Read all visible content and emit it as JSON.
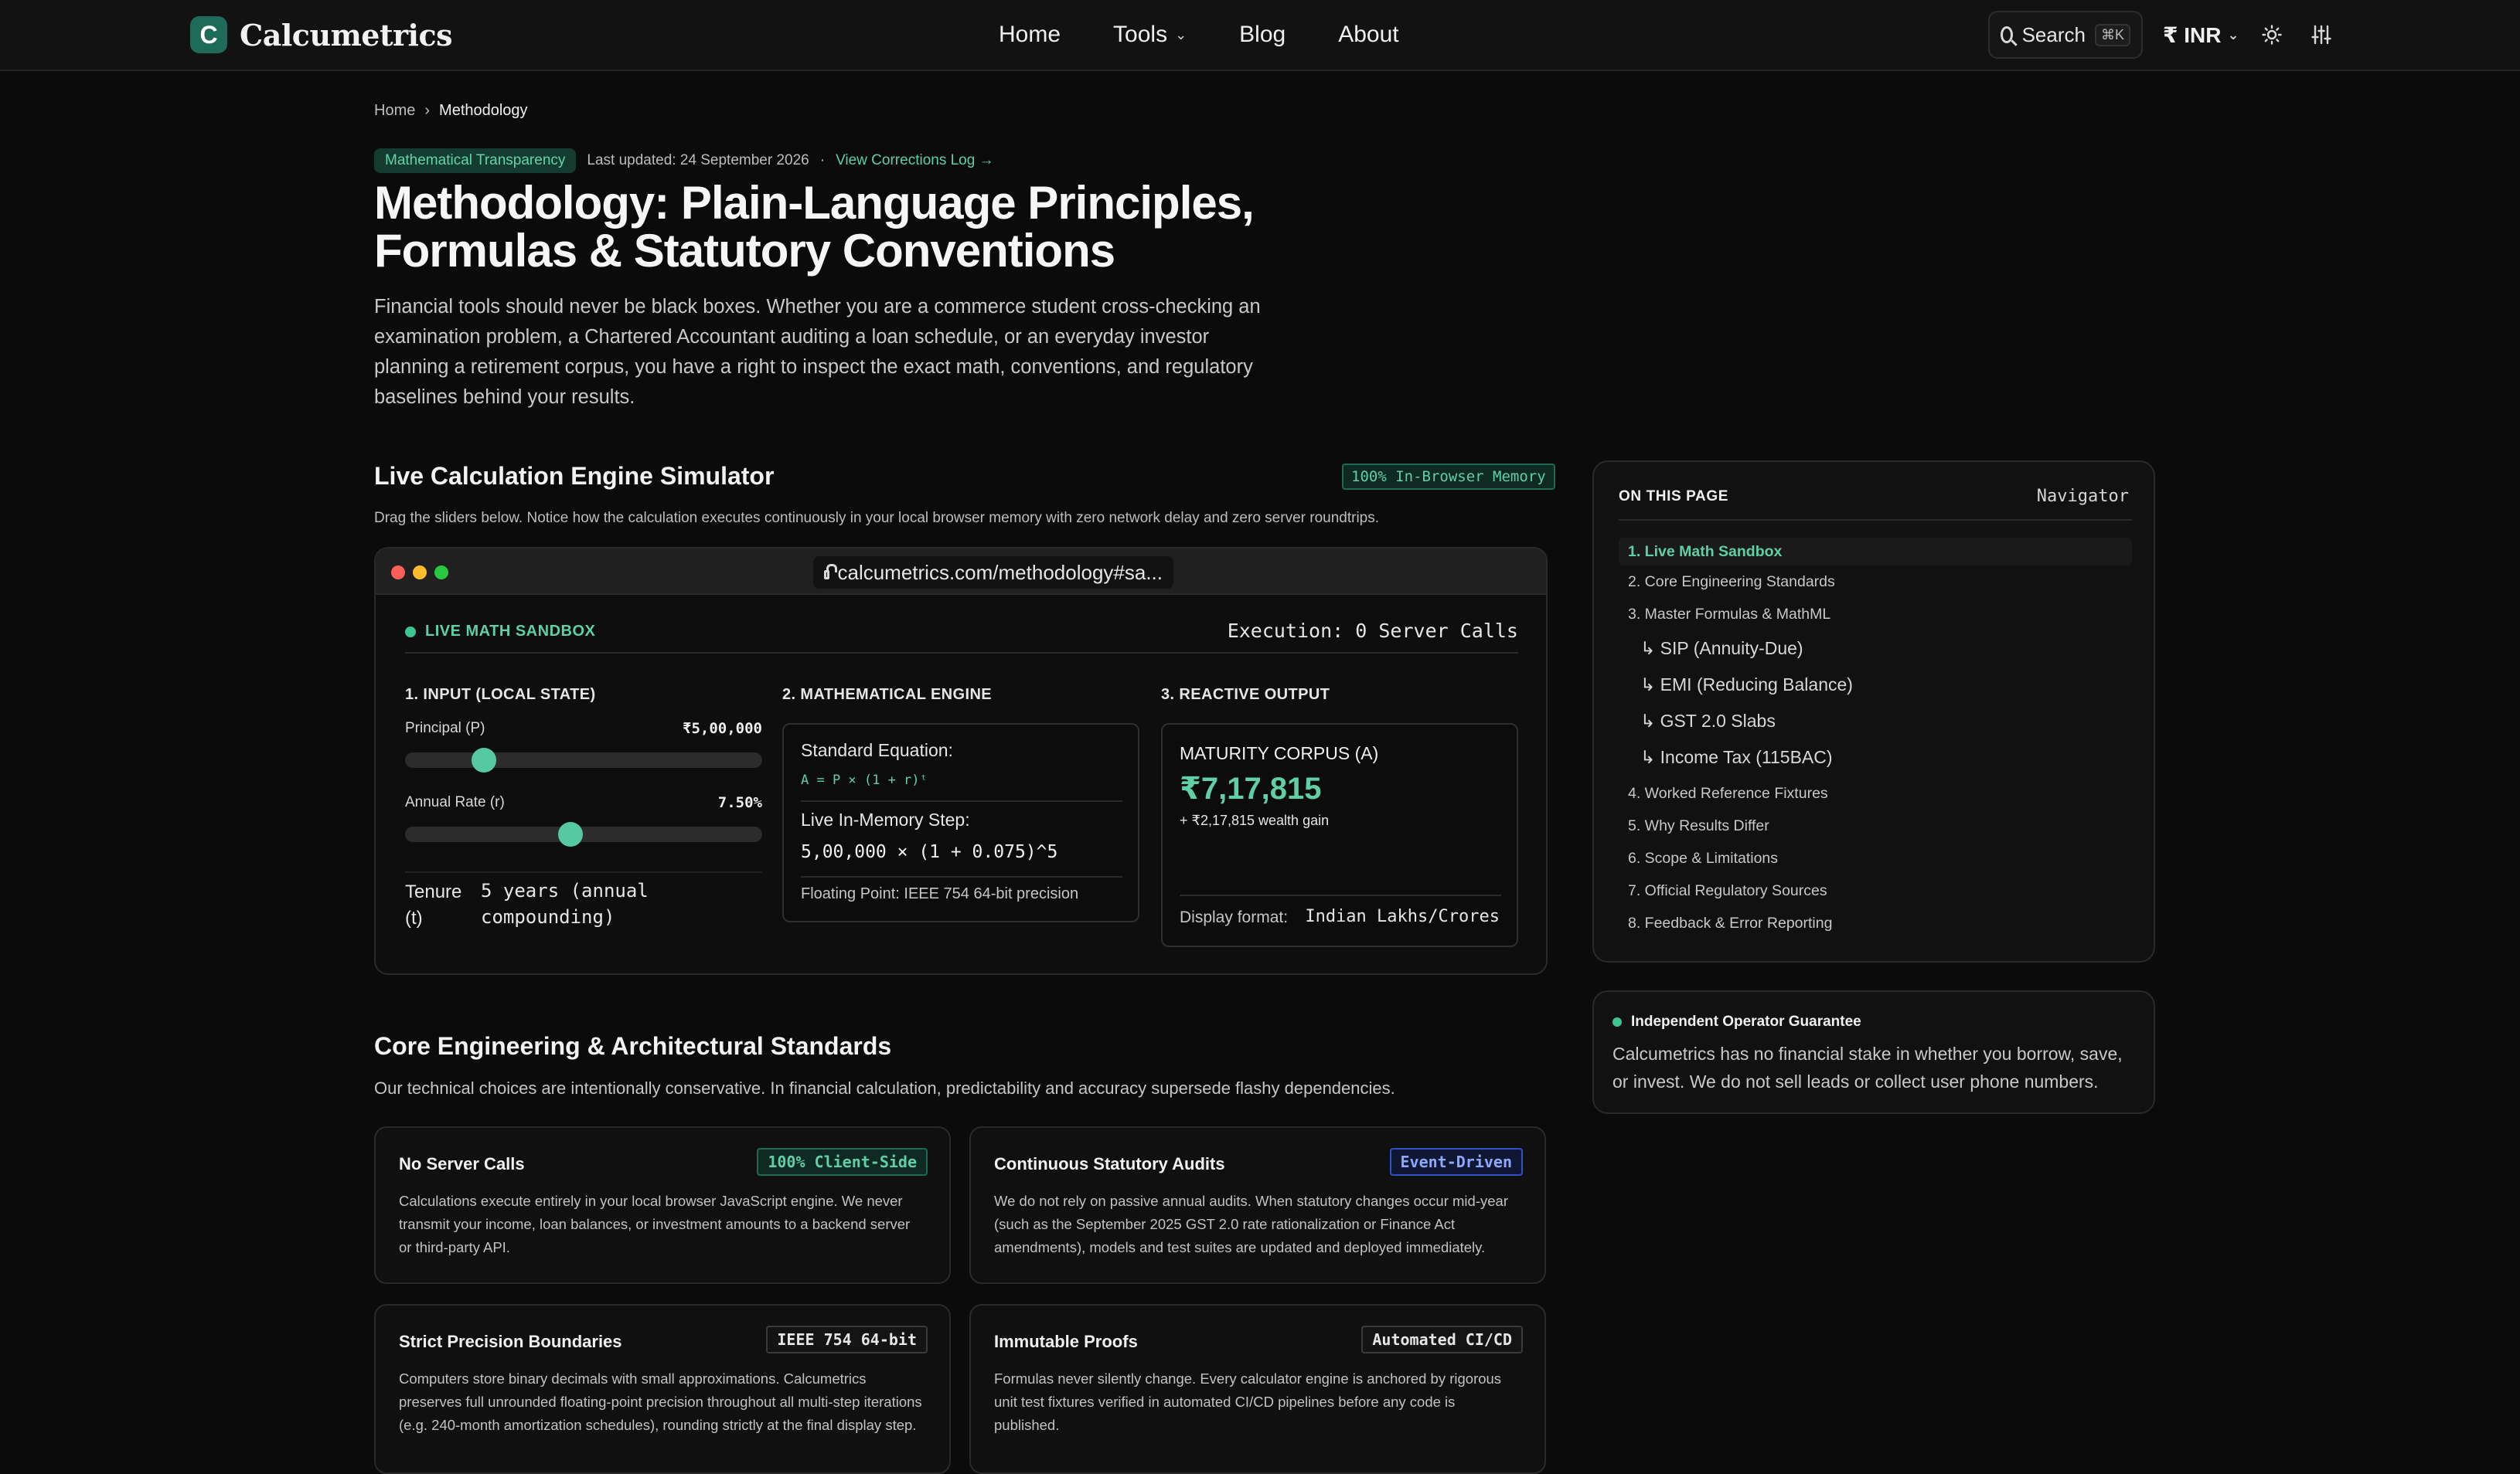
{
  "header": {
    "logo_letter": "C",
    "brand": "Calcumetrics",
    "nav": [
      {
        "label": "Home",
        "has_menu": false
      },
      {
        "label": "Tools",
        "has_menu": true
      },
      {
        "label": "Blog",
        "has_menu": false
      },
      {
        "label": "About",
        "has_menu": false
      }
    ],
    "search_label": "Search",
    "search_shortcut": "⌘K",
    "currency": "₹ INR"
  },
  "breadcrumb": {
    "home": "Home",
    "separator": "›",
    "current": "Methodology"
  },
  "meta": {
    "badge": "Mathematical Transparency",
    "updated": "Last updated: 24 September 2026",
    "dot": "·",
    "corrections_link": "View Corrections Log →"
  },
  "page_title": "Methodology: Plain-Language Principles, Formulas & Statutory Conventions",
  "lead": "Financial tools should never be black boxes. Whether you are a commerce student cross-checking an examination problem, a Chartered Accountant auditing a loan schedule, or an everyday investor planning a retirement corpus, you have a right to inspect the exact math, conventions, and regulatory baselines behind your results.",
  "simulator": {
    "title": "Live Calculation Engine Simulator",
    "badge": "100% In-Browser Memory",
    "description": "Drag the sliders below. Notice how the calculation executes continuously in your local browser memory with zero network delay and zero server roundtrips.",
    "url": "calcumetrics.com/methodology#sa...",
    "sandbox_label": "LIVE MATH SANDBOX",
    "execution": "Execution: 0 Server Calls",
    "input": {
      "heading": "1. INPUT (LOCAL STATE)",
      "principal_label": "Principal (P)",
      "principal_value": "₹5,00,000",
      "principal_fraction": 0.2,
      "rate_label": "Annual Rate (r)",
      "rate_value": "7.50%",
      "rate_fraction": 0.46,
      "tenure_label": "Tenure (t)",
      "tenure_value": "5 years (annual compounding)"
    },
    "engine": {
      "heading": "2. MATHEMATICAL ENGINE",
      "standard_label": "Standard Equation:",
      "standard_formula": "A = P × (1 + r)ᵗ",
      "live_label": "Live In-Memory Step:",
      "live_formula": "5,00,000 × (1 + 0.075)^5",
      "floating_point": "Floating Point: IEEE 754 64-bit precision"
    },
    "output": {
      "heading": "3. REACTIVE OUTPUT",
      "label": "MATURITY CORPUS (A)",
      "value": "₹7,17,815",
      "gain": "+ ₹2,17,815 wealth gain",
      "display_label": "Display format:",
      "display_value": "Indian Lakhs/Crores"
    }
  },
  "core": {
    "title": "Core Engineering & Architectural Standards",
    "description": "Our technical choices are intentionally conservative. In financial calculation, predictability and accuracy supersede flashy dependencies.",
    "cards": [
      {
        "title": "No Server Calls",
        "tag": "100% Client-Side",
        "body": "Calculations execute entirely in your local browser JavaScript engine. We never transmit your income, loan balances, or investment amounts to a backend server or third-party API."
      },
      {
        "title": "Continuous Statutory Audits",
        "tag": "Event-Driven",
        "body": "We do not rely on passive annual audits. When statutory changes occur mid-year (such as the September 2025 GST 2.0 rate rationalization or Finance Act amendments), models and test suites are updated and deployed immediately."
      },
      {
        "title": "Strict Precision Boundaries",
        "tag": "IEEE 754 64-bit",
        "body": "Computers store binary decimals with small approximations. Calcumetrics preserves full unrounded floating-point precision throughout all multi-step iterations (e.g. 240-month amortization schedules), rounding strictly at the final display step."
      },
      {
        "title": "Immutable Proofs",
        "tag": "Automated CI/CD",
        "body": "Formulas never silently change. Every calculator engine is anchored by rigorous unit test fixtures verified in automated CI/CD pipelines before any code is published."
      }
    ]
  },
  "toc": {
    "heading": "ON THIS PAGE",
    "nav_label": "Navigator",
    "items": [
      "1. Live Math Sandbox",
      "2. Core Engineering Standards",
      "3. Master Formulas & MathML",
      "↳ SIP (Annuity-Due)",
      "↳ EMI (Reducing Balance)",
      "↳ GST 2.0 Slabs",
      "↳ Income Tax (115BAC)",
      "4. Worked Reference Fixtures",
      "5. Why Results Differ",
      "6. Scope & Limitations",
      "7. Official Regulatory Sources",
      "8. Feedback & Error Reporting"
    ]
  },
  "guarantee": {
    "heading": "Independent Operator Guarantee",
    "body": "Calcumetrics has no financial stake in whether you borrow, save, or invest. We do not sell leads or collect user phone numbers."
  },
  "colors": {
    "accent": "#5fd0a6",
    "brand": "#1e6b58",
    "mac_red": "#ff5f57",
    "mac_yellow": "#febc2e",
    "mac_green": "#28c840",
    "event_blue": "#8ea8ff"
  },
  "icons": [
    "search-icon",
    "chevron-down-icon",
    "sun-icon",
    "sliders-icon",
    "lock-icon"
  ]
}
